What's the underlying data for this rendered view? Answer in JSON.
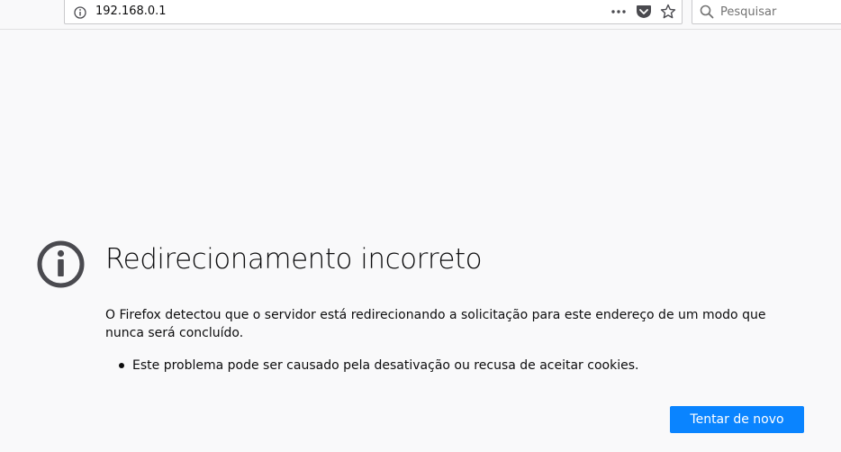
{
  "browser": {
    "url": "192.168.0.1",
    "search_placeholder": "Pesquisar",
    "icons": {
      "site_info": "info-circle-icon",
      "page_actions": "ellipsis-icon",
      "pocket": "pocket-icon",
      "bookmark": "star-icon",
      "search": "magnifier-icon"
    }
  },
  "error_page": {
    "icon": "info-circle-icon",
    "title": "Redirecionamento incorreto",
    "description": "O Firefox detectou que o servidor está redirecionando a solicitação para este endereço de um modo que nunca será concluído.",
    "causes": [
      "Este problema pode ser causado pela desativação ou recusa de aceitar cookies."
    ],
    "retry_label": "Tentar de novo"
  },
  "colors": {
    "accent": "#0a84ff",
    "icon": "#4a4a4f",
    "background": "#f9f9fa"
  }
}
